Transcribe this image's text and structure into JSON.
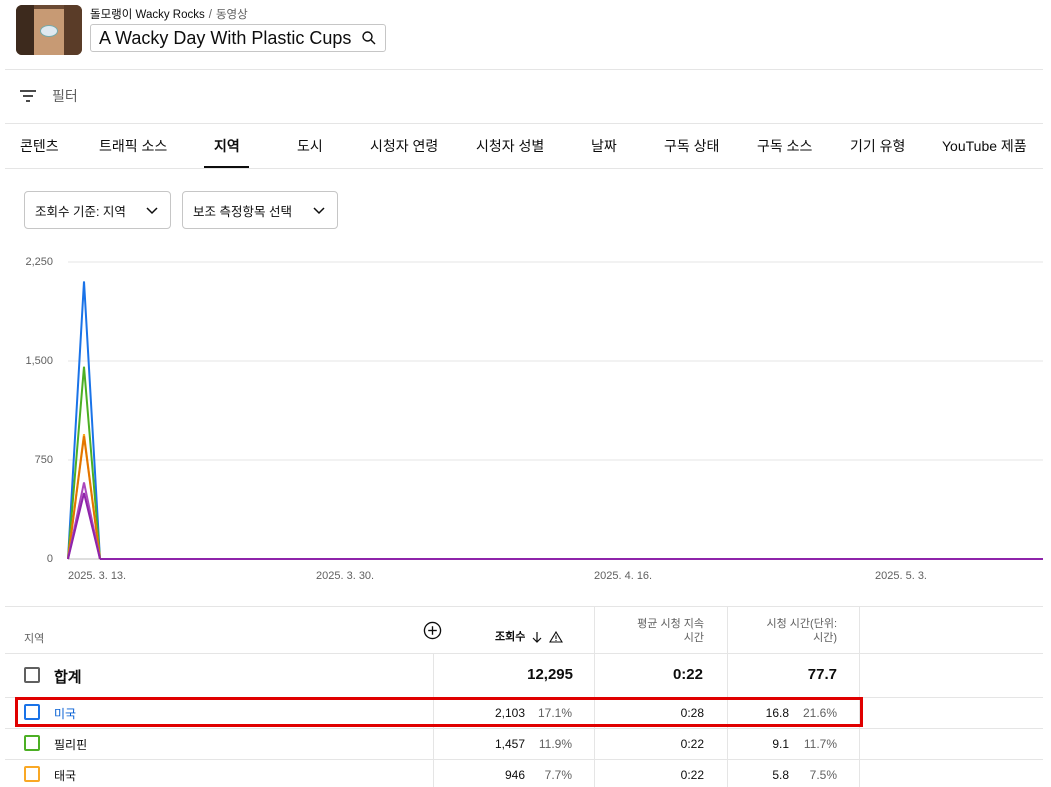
{
  "header": {
    "channel": "돌모랭이 Wacky Rocks",
    "separator": "/",
    "section": "동영상",
    "video_title": "A Wacky Day With Plastic Cups"
  },
  "filter": {
    "label": "필터"
  },
  "tabs": [
    "콘텐츠",
    "트래픽 소스",
    "지역",
    "도시",
    "시청자 연령",
    "시청자 성별",
    "날짜",
    "구독 상태",
    "구독 소스",
    "기기 유형",
    "YouTube 제품"
  ],
  "active_tab": "지역",
  "dropdowns": {
    "primary": "조회수 기준: 지역",
    "secondary": "보조 측정항목 선택"
  },
  "chart_data": {
    "type": "line",
    "y_ticks": [
      "2,250",
      "1,500",
      "750",
      "0"
    ],
    "x_ticks": [
      "2025. 3. 13.",
      "2025. 3. 30.",
      "2025. 4. 16.",
      "2025. 5. 3."
    ],
    "ylim": [
      0,
      2250
    ],
    "series": [
      {
        "name": "미국",
        "color": "#1a73e8",
        "values": [
          0,
          2103,
          0
        ]
      },
      {
        "name": "필리핀",
        "color": "#4caf24",
        "values": [
          0,
          1457,
          0
        ]
      },
      {
        "name": "태국",
        "color": "#f9a825",
        "values": [
          0,
          946,
          0
        ]
      },
      {
        "color": "#e37400",
        "values": [
          0,
          930,
          0
        ]
      },
      {
        "color": "#ab47bc",
        "values": [
          0,
          580,
          0
        ]
      },
      {
        "color": "#8e24aa",
        "values": [
          0,
          500,
          0
        ]
      }
    ]
  },
  "table": {
    "headers": {
      "region": "지역",
      "views": "조회수",
      "avg_duration_l1": "평균 시청 지속",
      "avg_duration_l2": "시간",
      "watch_time_l1": "시청 시간(단위:",
      "watch_time_l2": "시간)"
    },
    "total": {
      "label": "합계",
      "views": "12,295",
      "avg": "0:22",
      "watch": "77.7"
    },
    "rows": [
      {
        "name": "미국",
        "views": "2,103",
        "views_pct": "17.1%",
        "avg": "0:28",
        "watch": "16.8",
        "watch_pct": "21.6%",
        "color": "#1a73e8"
      },
      {
        "name": "필리핀",
        "views": "1,457",
        "views_pct": "11.9%",
        "avg": "0:22",
        "watch": "9.1",
        "watch_pct": "11.7%",
        "color": "#4caf24"
      },
      {
        "name": "태국",
        "views": "946",
        "views_pct": "7.7%",
        "avg": "0:22",
        "watch": "5.8",
        "watch_pct": "7.5%",
        "color": "#f9a825"
      }
    ]
  }
}
